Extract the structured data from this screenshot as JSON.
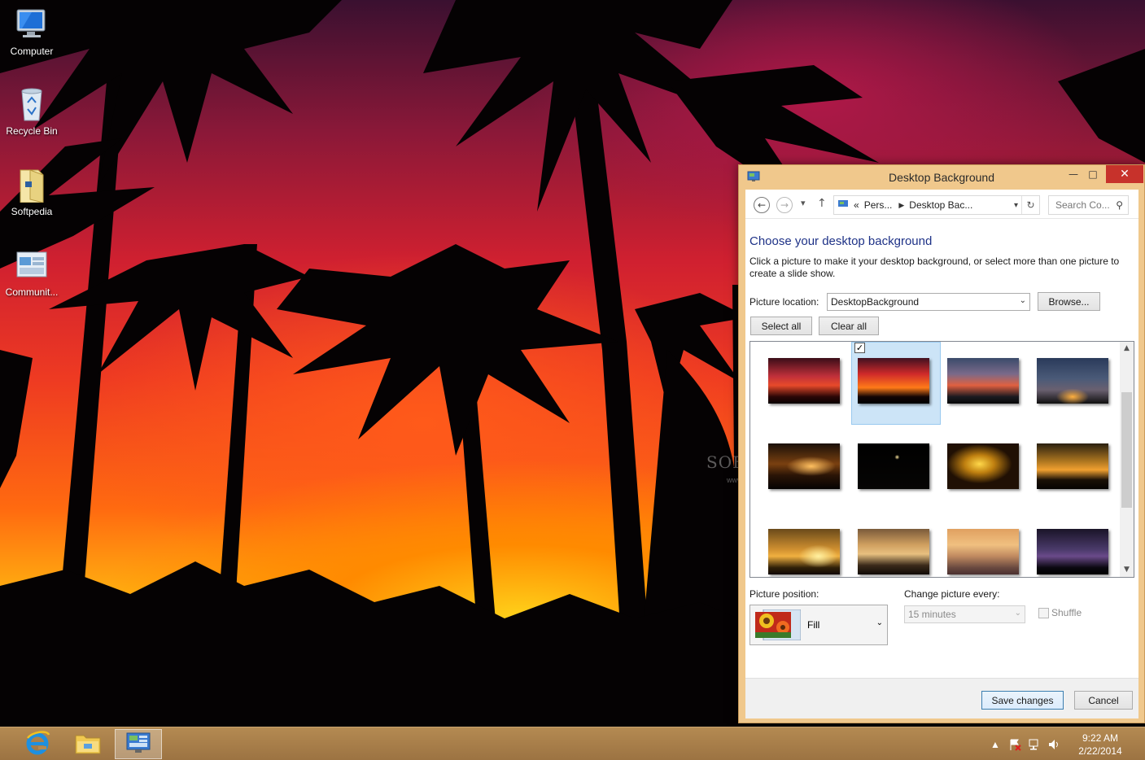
{
  "desktop": {
    "icons": [
      {
        "label": "Computer"
      },
      {
        "label": "Recycle Bin"
      },
      {
        "label": "Softpedia"
      },
      {
        "label": "Communit..."
      }
    ],
    "watermark": "SOFTPEDIA",
    "watermark_sub": "www.softpedia.com"
  },
  "window": {
    "title": "Desktop Background",
    "minimize_glyph": "—",
    "maximize_glyph": "□",
    "close_glyph": "✕",
    "nav": {
      "back_glyph": "←",
      "forward_glyph": "→",
      "recent_glyph": "▾",
      "up_glyph": "↑",
      "breadcrumb_prefix": "«",
      "breadcrumb": [
        "Pers...",
        "Desktop Bac..."
      ],
      "refresh_glyph": "↻",
      "search_placeholder": "Search Co...",
      "search_glyph": "⚲"
    },
    "heading": "Choose your desktop background",
    "description": "Click a picture to make it your desktop background, or select more than one picture to create a slide show.",
    "picture_location_label": "Picture location:",
    "picture_location_value": "DesktopBackground",
    "browse_label": "Browse...",
    "select_all_label": "Select all",
    "clear_all_label": "Clear all",
    "thumbnails": [
      {
        "selected": false
      },
      {
        "selected": true
      },
      {
        "selected": false
      },
      {
        "selected": false
      },
      {
        "selected": false
      },
      {
        "selected": false
      },
      {
        "selected": false
      },
      {
        "selected": false
      },
      {
        "selected": false
      },
      {
        "selected": false
      },
      {
        "selected": false
      },
      {
        "selected": false
      }
    ],
    "picture_position_label": "Picture position:",
    "picture_position_value": "Fill",
    "change_every_label": "Change picture every:",
    "change_every_value": "15 minutes",
    "shuffle_label": "Shuffle",
    "save_label": "Save changes",
    "cancel_label": "Cancel"
  },
  "tray": {
    "time": "9:22 AM",
    "date": "2/22/2014",
    "show_hidden_glyph": "▲"
  },
  "colors": {
    "window_frame": "#f0c88c",
    "close_button": "#c7322b",
    "heading": "#1e3287",
    "taskbar": "#a88050",
    "selection": "#cce4f7"
  }
}
